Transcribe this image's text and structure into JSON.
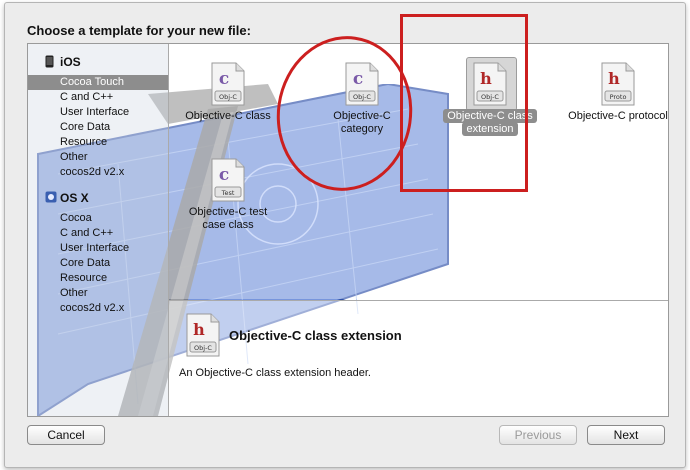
{
  "heading": "Choose a template for your new file:",
  "sidebar": {
    "sections": [
      {
        "label": "iOS",
        "icon": "ios-device-icon",
        "items": [
          "Cocoa Touch",
          "C and C++",
          "User Interface",
          "Core Data",
          "Resource",
          "Other",
          "cocos2d v2.x"
        ]
      },
      {
        "label": "OS X",
        "icon": "os-x-icon",
        "items": [
          "Cocoa",
          "C and C++",
          "User Interface",
          "Core Data",
          "Resource",
          "Other",
          "cocos2d v2.x"
        ]
      }
    ],
    "selected_item": "Cocoa Touch"
  },
  "templates": [
    {
      "name": "Objective-C class",
      "glyph": "c",
      "tag": "Obj-C",
      "selected": false
    },
    {
      "name": "Objective-C category",
      "glyph": "c",
      "tag": "Obj-C",
      "selected": false
    },
    {
      "name": "Objective-C class extension",
      "glyph": "h",
      "tag": "Obj-C",
      "selected": true
    },
    {
      "name": "Objective-C protocol",
      "glyph": "h",
      "tag": "Proto",
      "selected": false
    },
    {
      "name": "Objective-C test case class",
      "glyph": "c",
      "tag": "Test",
      "selected": false
    }
  ],
  "template_captions": {
    "t0": [
      "Objective-C class"
    ],
    "t1": [
      "Objective-C",
      "category"
    ],
    "t2": [
      "Objective-C class",
      "extension"
    ],
    "t3": [
      "Objective-C protocol"
    ],
    "t4": [
      "Objective-C test",
      "case class"
    ]
  },
  "description": {
    "title": "Objective-C class extension",
    "text": "An Objective-C class extension header.",
    "glyph": "h",
    "tag": "Obj-C"
  },
  "buttons": {
    "cancel": "Cancel",
    "previous": "Previous",
    "next": "Next"
  },
  "colors": {
    "annotation": "#cc1f1f",
    "selection": "#8d8d8d",
    "blueprint": "#3f66c8",
    "glyph_c": "#7a5aa8",
    "glyph_h": "#b02828"
  }
}
